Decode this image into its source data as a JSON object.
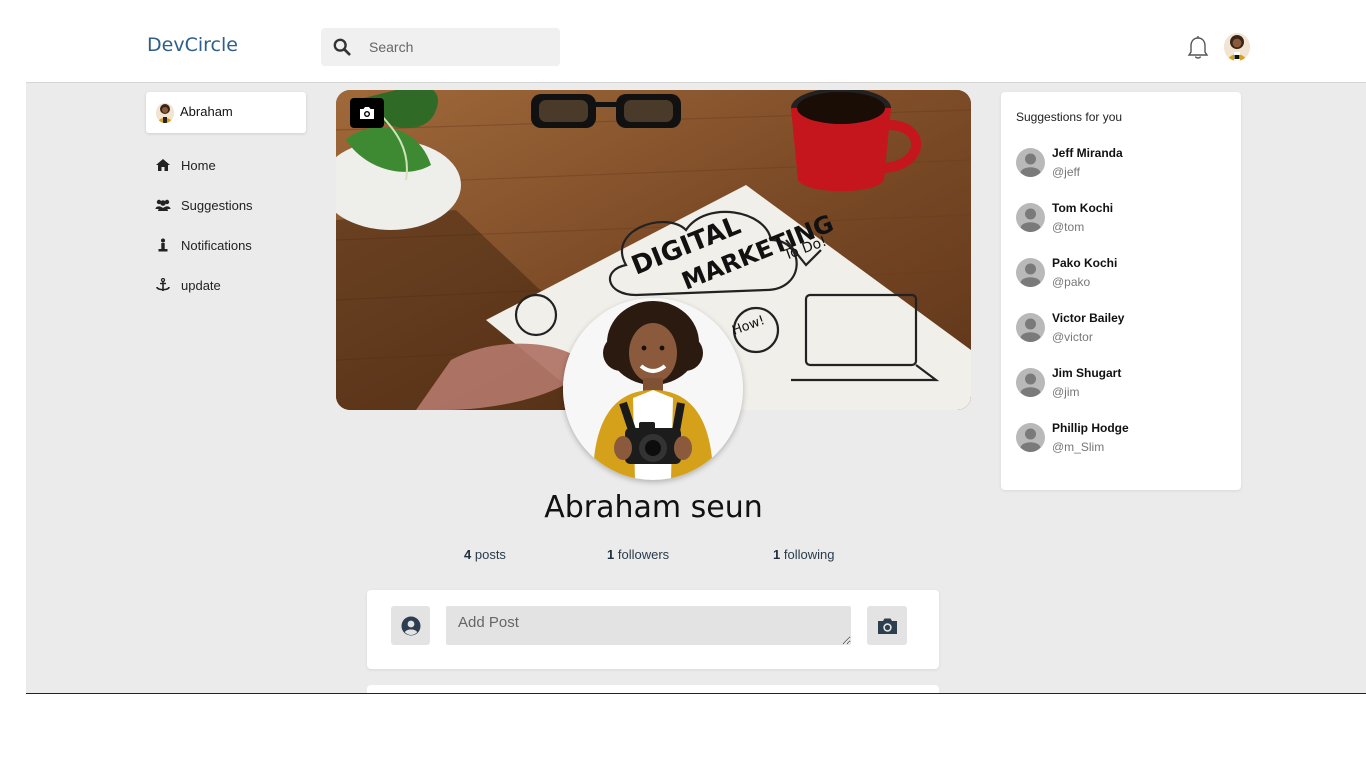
{
  "header": {
    "brand": "DevCircle",
    "search_placeholder": "Search"
  },
  "sidebar": {
    "user_name": "Abraham",
    "items": [
      {
        "label": "Home",
        "icon": "home-icon"
      },
      {
        "label": "Suggestions",
        "icon": "users-icon"
      },
      {
        "label": "Notifications",
        "icon": "person-icon"
      },
      {
        "label": "update",
        "icon": "anchor-icon"
      }
    ]
  },
  "profile": {
    "full_name": "Abraham seun",
    "stats": [
      {
        "count": "4",
        "label": "posts"
      },
      {
        "count": "1",
        "label": "followers"
      },
      {
        "count": "1",
        "label": "following"
      }
    ]
  },
  "composer": {
    "placeholder": "Add Post"
  },
  "suggestions": {
    "title": "Suggestions for you",
    "people": [
      {
        "name": "Jeff Miranda",
        "handle": "@jeff"
      },
      {
        "name": "Tom Kochi",
        "handle": "@tom"
      },
      {
        "name": "Pako Kochi",
        "handle": "@pako"
      },
      {
        "name": "Victor Bailey",
        "handle": "@victor"
      },
      {
        "name": "Jim Shugart",
        "handle": "@jim"
      },
      {
        "name": "Phillip Hodge",
        "handle": "@m_Slim"
      }
    ]
  },
  "colors": {
    "brand": "#2d5f8a",
    "background": "#ebebeb",
    "card": "#ffffff"
  }
}
